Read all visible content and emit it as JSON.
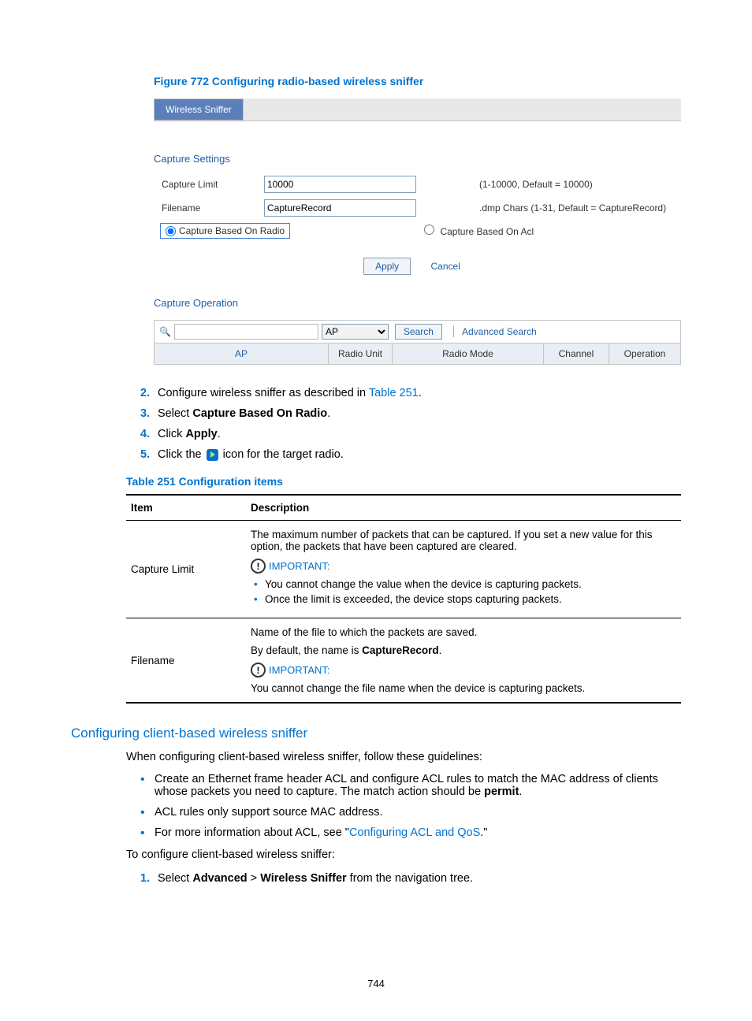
{
  "figure": {
    "caption": "Figure 772 Configuring radio-based wireless sniffer"
  },
  "ui": {
    "tab": "Wireless Sniffer",
    "captureSettingsTitle": "Capture Settings",
    "captureLimit": {
      "label": "Capture Limit",
      "value": "10000",
      "hint": "(1-10000, Default = 10000)"
    },
    "filename": {
      "label": "Filename",
      "value": "CaptureRecord",
      "hint": ".dmp Chars (1-31, Default = CaptureRecord)"
    },
    "radioOpt": "Capture Based On Radio",
    "aclOpt": "Capture Based On Acl",
    "applyBtn": "Apply",
    "cancelBtn": "Cancel",
    "captureOperationTitle": "Capture Operation",
    "selectValue": "AP",
    "searchBtn": "Search",
    "advSearch": "Advanced Search",
    "th": {
      "ap": "AP",
      "radioUnit": "Radio Unit",
      "radioMode": "Radio Mode",
      "channel": "Channel",
      "operation": "Operation"
    }
  },
  "steps": {
    "s2a": "Configure wireless sniffer as described in ",
    "s2link": "Table 251",
    "s2b": ".",
    "s3a": "Select ",
    "s3b": "Capture Based On Radio",
    "s3c": ".",
    "s4a": "Click ",
    "s4b": "Apply",
    "s4c": ".",
    "s5a": "Click the ",
    "s5b": " icon for the target radio."
  },
  "table": {
    "caption": "Table 251 Configuration items",
    "hItem": "Item",
    "hDesc": "Description",
    "r1Item": "Capture Limit",
    "r1p1": "The maximum number of packets that can be captured. If you set a new value for this option, the packets that have been captured are cleared.",
    "imp": "IMPORTANT:",
    "r1b1": "You cannot change the value when the device is capturing packets.",
    "r1b2": "Once the limit is exceeded, the device stops capturing packets.",
    "r2Item": "Filename",
    "r2p1": "Name of the file to which the packets are saved.",
    "r2p2a": "By default, the name is ",
    "r2p2b": "CaptureRecord",
    "r2p2c": ".",
    "r2p3": "You cannot change the file name when the device is capturing packets."
  },
  "section2": {
    "title": "Configuring client-based wireless sniffer",
    "intro": "When configuring client-based wireless sniffer, follow these guidelines:",
    "b1a": "Create an Ethernet frame header ACL and configure ACL rules to match the MAC address of clients whose packets you need to capture. The match action should be ",
    "b1b": "permit",
    "b1c": ".",
    "b2": "ACL rules only support source MAC address.",
    "b3a": "For more information about ACL, see \"",
    "b3link": "Configuring ACL and QoS",
    "b3b": ".\"",
    "toConfigure": "To configure client-based wireless sniffer:",
    "step1a": "Select ",
    "step1b": "Advanced",
    "step1c": " > ",
    "step1d": "Wireless Sniffer",
    "step1e": " from the navigation tree."
  },
  "pagenum": "744"
}
